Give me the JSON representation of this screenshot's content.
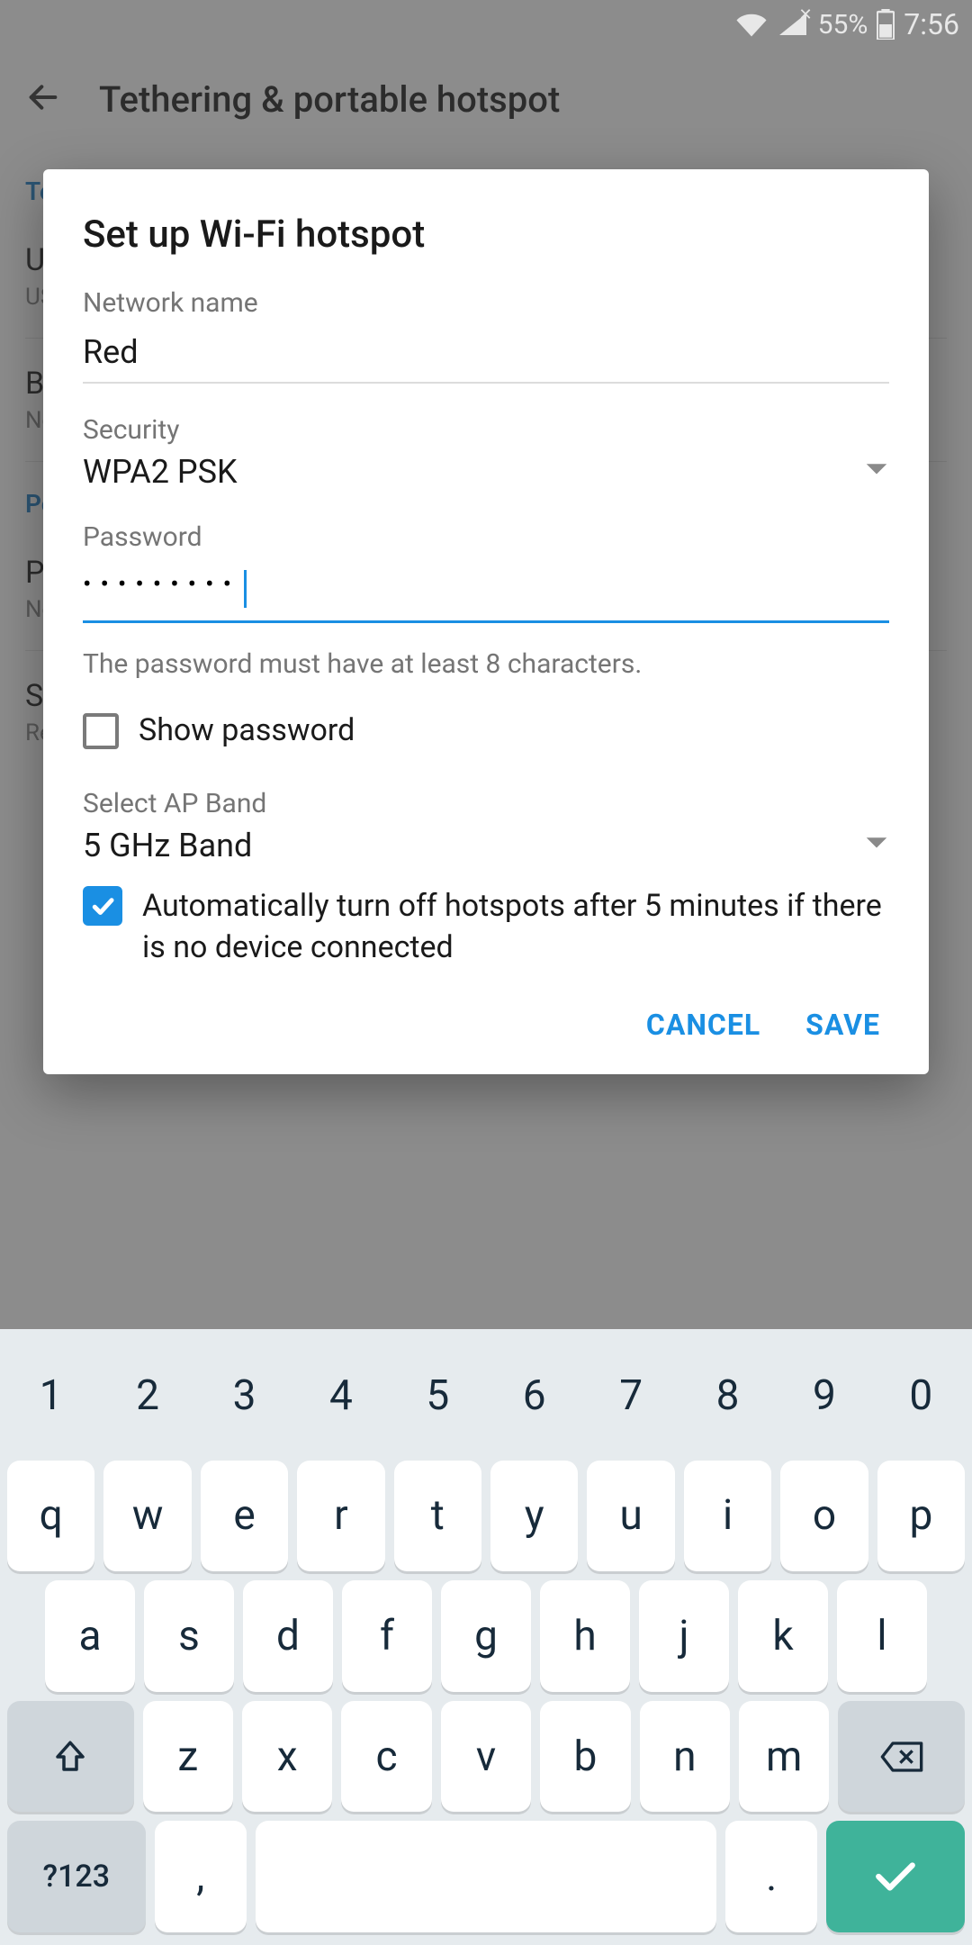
{
  "status": {
    "battery": "55%",
    "time": "7:56"
  },
  "background": {
    "title": "Tethering & portable hotspot",
    "section1": "Tethering",
    "section2_prefix": "Po",
    "items": [
      {
        "title_prefix": "U",
        "sub_prefix": "US"
      },
      {
        "title_prefix": "Bl",
        "sub_prefix": "No"
      },
      {
        "title_prefix": "Po",
        "sub_prefix": "No"
      },
      {
        "title_prefix": "Se",
        "sub_prefix": "Re"
      }
    ]
  },
  "dialog": {
    "title": "Set up Wi-Fi hotspot",
    "network_name_label": "Network name",
    "network_name_value": "Red",
    "security_label": "Security",
    "security_value": "WPA2 PSK",
    "password_label": "Password",
    "password_masked": "•••••••••",
    "password_helper": "The password must have at least 8 characters.",
    "show_password_label": "Show password",
    "show_password_checked": false,
    "ap_band_label": "Select AP Band",
    "ap_band_value": "5 GHz Band",
    "auto_off_label": "Automatically turn off hotspots after 5 minutes if there is no device connected",
    "auto_off_checked": true,
    "cancel": "CANCEL",
    "save": "SAVE"
  },
  "keyboard": {
    "row_num": [
      "1",
      "2",
      "3",
      "4",
      "5",
      "6",
      "7",
      "8",
      "9",
      "0"
    ],
    "row1": [
      "q",
      "w",
      "e",
      "r",
      "t",
      "y",
      "u",
      "i",
      "o",
      "p"
    ],
    "row2": [
      "a",
      "s",
      "d",
      "f",
      "g",
      "h",
      "j",
      "k",
      "l"
    ],
    "row3": [
      "z",
      "x",
      "c",
      "v",
      "b",
      "n",
      "m"
    ],
    "symkey": "?123",
    "comma": ",",
    "period": "."
  }
}
